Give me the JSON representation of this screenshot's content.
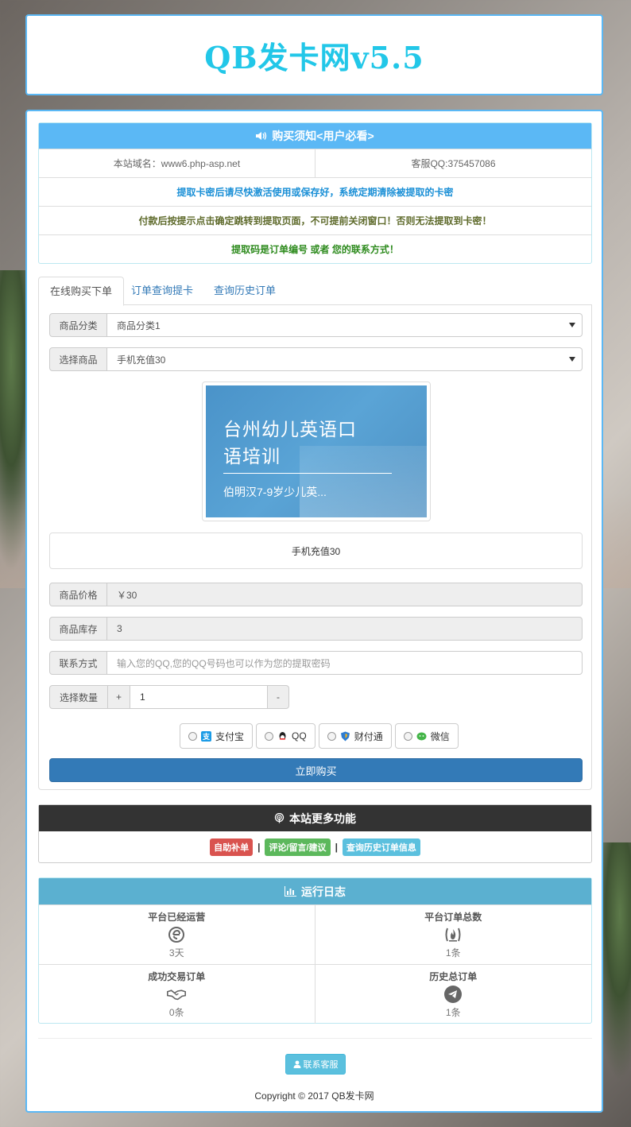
{
  "site_title": "QB发卡网v5.5",
  "notice": {
    "heading": "购买须知<用户必看>",
    "domain": "本站域名：www6.php-asp.net",
    "service_qq": "客服QQ:375457086",
    "line1": "提取卡密后请尽快激活使用或保存好，系统定期清除被提取的卡密",
    "line2": "付款后按提示点击确定跳转到提取页面，不可提前关闭窗口！否则无法提取到卡密！",
    "line3": "提取码是订单编号 或者 您的联系方式！"
  },
  "tabs": [
    "在线购买下单",
    "订单查询提卡",
    "查询历史订单"
  ],
  "form": {
    "category_label": "商品分类",
    "category_value": "商品分类1",
    "product_label": "选择商品",
    "product_value": "手机充值30",
    "promo": {
      "line1": "台州幼儿英语口",
      "line2": "语培训",
      "sub": "伯明汉7-9岁少儿英..."
    },
    "description": "手机充值30",
    "price_label": "商品价格",
    "price_value": "￥30",
    "stock_label": "商品库存",
    "stock_value": "3",
    "contact_label": "联系方式",
    "contact_placeholder": "输入您的QQ,您的QQ号码也可以作为您的提取密码",
    "qty_label": "选择数量",
    "qty_plus": "+",
    "qty_value": "1",
    "qty_minus": "-",
    "payments": [
      {
        "label": "支付宝",
        "icon": "alipay-icon",
        "color": "#1a9be6"
      },
      {
        "label": "QQ",
        "icon": "qq-icon",
        "color": "#222222"
      },
      {
        "label": "财付通",
        "icon": "tenpay-icon",
        "color": "#2d7dd2"
      },
      {
        "label": "微信",
        "icon": "wechat-icon",
        "color": "#44b549"
      }
    ],
    "buy_label": "立即购买"
  },
  "more": {
    "heading": "本站更多功能",
    "links": [
      {
        "label": "自助补单",
        "color": "#d9534f"
      },
      {
        "label": "评论/留言/建议",
        "color": "#5cb85c"
      },
      {
        "label": "查询历史订单信息",
        "color": "#5bc0de"
      }
    ],
    "separator": "|"
  },
  "log": {
    "heading": "运行日志",
    "cells": [
      {
        "title": "平台已经运营",
        "value": "3天",
        "icon": "ie-icon"
      },
      {
        "title": "平台订单总数",
        "value": "1条",
        "icon": "fire-icon"
      },
      {
        "title": "成功交易订单",
        "value": "0条",
        "icon": "handshake-icon"
      },
      {
        "title": "历史总订单",
        "value": "1条",
        "icon": "telegram-icon"
      }
    ]
  },
  "contact_service": "联系客服",
  "copyright": "Copyright © 2017 QB发卡网",
  "colors": {
    "accent": "#5bb8f5",
    "title": "#22c7e8",
    "buy_button": "#337ab7",
    "log_header": "#5bb0d0"
  }
}
